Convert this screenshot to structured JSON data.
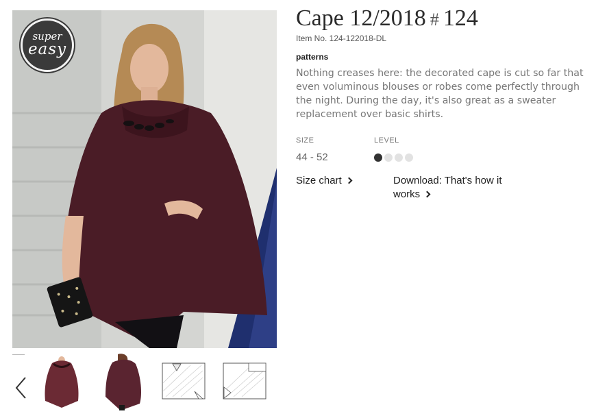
{
  "product": {
    "title_main": "Cape 12/2018",
    "title_hash": "#",
    "title_number": "124",
    "item_no": "Item No. 124-122018-DL",
    "category_link": "patterns",
    "description": "Nothing creases here: the decorated cape is cut so far that even voluminous blouses or robes come perfectly through the night. During the day, it's also great as a sweater replacement over basic shirts."
  },
  "badge": {
    "line1": "super",
    "line2": "easy"
  },
  "specs": {
    "size_label": "SIZE",
    "size_value": "44 - 52",
    "level_label": "LEVEL",
    "level_filled": 1,
    "level_total": 4
  },
  "links": {
    "size_chart": "Size chart",
    "download_line1": "Download: That's how it",
    "download_line2": "works"
  },
  "icons": {
    "prev": "chevron-left-icon",
    "link_arrow": "chevron-right-icon"
  },
  "colors": {
    "cape": "#4a1c26",
    "level_on": "#333333",
    "level_off": "#e2e2e2"
  }
}
